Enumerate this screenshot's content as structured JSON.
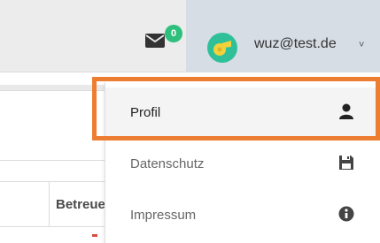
{
  "header": {
    "mail_badge": "0",
    "user_email": "wuz@test.de",
    "caret": "˅"
  },
  "background": {
    "column_header": "Betreuer"
  },
  "dropdown": {
    "items": [
      {
        "label": "Profil",
        "icon": "user-icon"
      },
      {
        "label": "Datenschutz",
        "icon": "save-icon"
      },
      {
        "label": "Impressum",
        "icon": "info-icon"
      }
    ]
  },
  "colors": {
    "accent": "#2fbf7d",
    "highlight": "#ed7d31",
    "topbar": "#ececec",
    "user_area": "#d7dde4"
  }
}
